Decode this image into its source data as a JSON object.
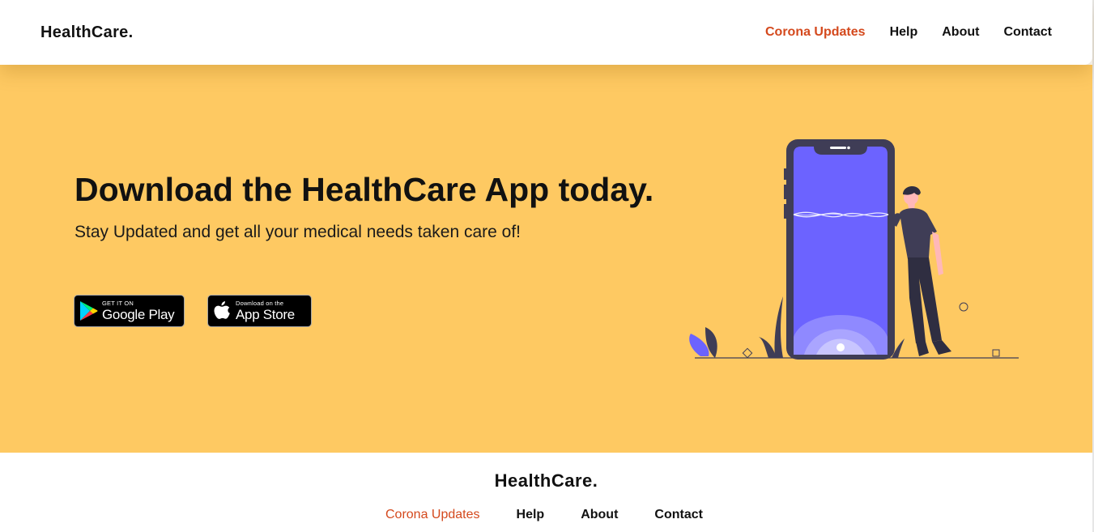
{
  "header": {
    "logo": "HealthCare.",
    "nav": [
      {
        "label": "Corona Updates",
        "active": true
      },
      {
        "label": "Help"
      },
      {
        "label": "About"
      },
      {
        "label": "Contact"
      }
    ]
  },
  "hero": {
    "title": "Download the HealthCare App today.",
    "subtitle": "Stay Updated and get all your medical needs taken care of!",
    "google_play": {
      "small": "GET IT ON",
      "big": "Google Play"
    },
    "app_store": {
      "small": "Download on the",
      "big": "App Store"
    }
  },
  "footer": {
    "logo": "HealthCare.",
    "nav": [
      {
        "label": "Corona Updates",
        "active": true
      },
      {
        "label": "Help"
      },
      {
        "label": "About"
      },
      {
        "label": "Contact"
      }
    ]
  },
  "colors": {
    "accent": "#d4491d",
    "hero_bg": "#fec962",
    "phone_screen": "#6c63ff",
    "dark": "#3f3d56",
    "skin": "#ffb8b8"
  },
  "icons": [
    "google-play-icon",
    "apple-icon"
  ]
}
